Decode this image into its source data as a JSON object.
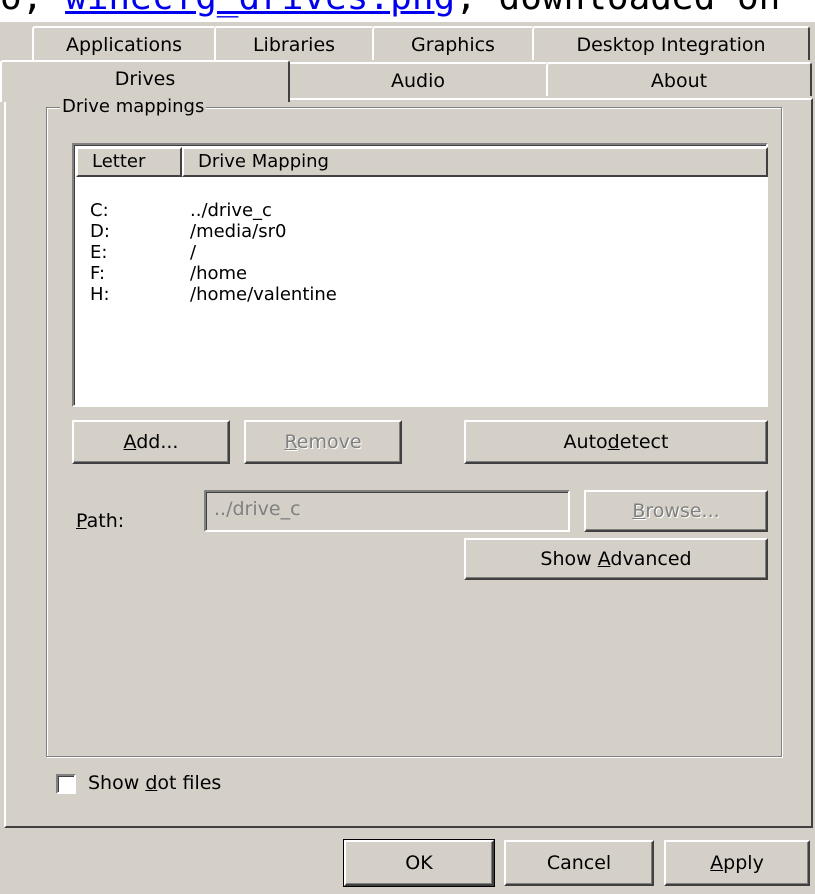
{
  "caption": {
    "prefix": "o,",
    "link": "winecfg_drives.png",
    "suffix": ", downloaded on"
  },
  "tabs_top": [
    "Applications",
    "Libraries",
    "Graphics",
    "Desktop Integration"
  ],
  "tabs_bottom": [
    "Drives",
    "Audio",
    "About"
  ],
  "selected_tab": "Drives",
  "drive_mappings": {
    "title": "Drive mappings",
    "columns": [
      "Letter",
      "Drive Mapping"
    ],
    "rows": [
      {
        "letter": "C:",
        "mapping": "../drive_c"
      },
      {
        "letter": "D:",
        "mapping": "/media/sr0"
      },
      {
        "letter": "E:",
        "mapping": "/"
      },
      {
        "letter": "F:",
        "mapping": "/home"
      },
      {
        "letter": "H:",
        "mapping": "/home/valentine"
      }
    ]
  },
  "buttons": {
    "add": {
      "pre": "",
      "u": "A",
      "post": "dd..."
    },
    "remove": {
      "pre": "",
      "u": "R",
      "post": "emove"
    },
    "autodetect": {
      "pre": "Auto",
      "u": "d",
      "post": "etect"
    },
    "browse": {
      "pre": "",
      "u": "B",
      "post": "rowse..."
    },
    "show_advanced": {
      "pre": "Show ",
      "u": "A",
      "post": "dvanced"
    }
  },
  "path": {
    "label_pre": "",
    "label_u": "P",
    "label_post": "ath:",
    "value": "../drive_c"
  },
  "show_dot_files": {
    "pre": "Show ",
    "u": "d",
    "post": "ot files",
    "checked": false
  },
  "footer": {
    "ok": "OK",
    "cancel": "Cancel",
    "apply": {
      "pre": "",
      "u": "A",
      "post": "pply"
    }
  }
}
